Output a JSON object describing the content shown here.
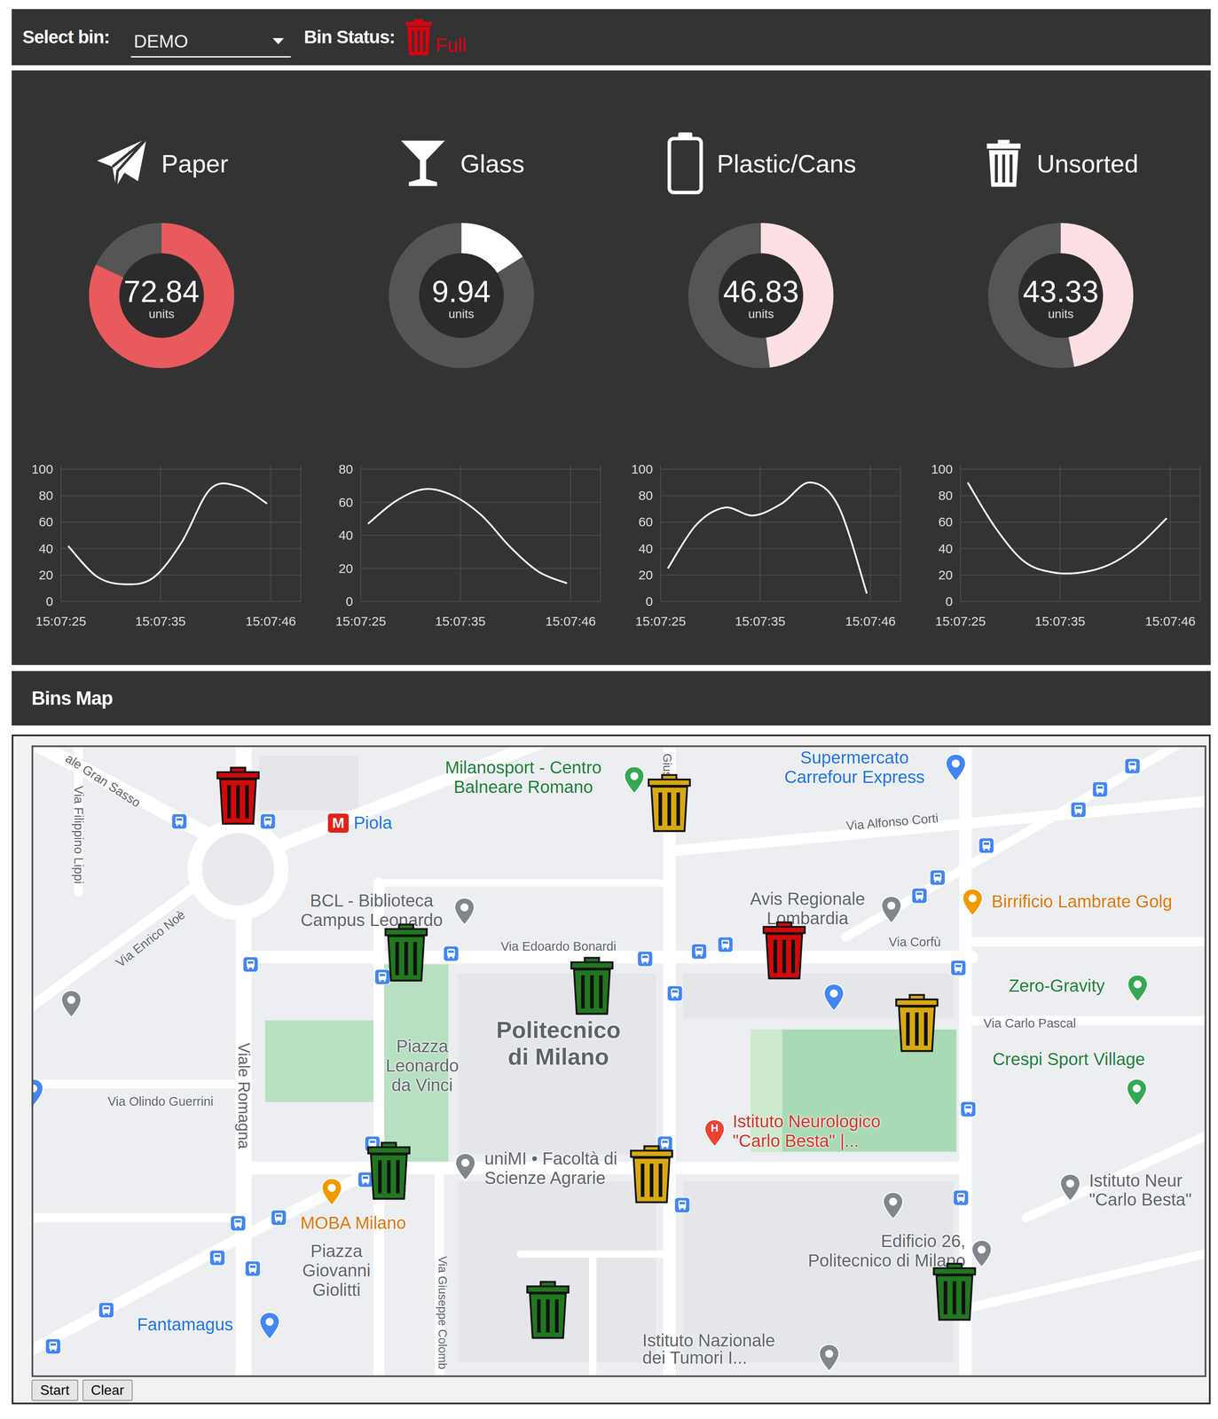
{
  "toolbar": {
    "select_label": "Select bin:",
    "selected_bin": "DEMO",
    "status_label": "Bin Status:",
    "status": "Full",
    "status_color": "#e0000f"
  },
  "gauges": [
    {
      "name": "Paper",
      "value": "72.84",
      "unit": "units",
      "level": 0.82,
      "color": "#e85a5e",
      "chart": {
        "y_ticks": [
          "100",
          "80",
          "60",
          "40",
          "20",
          "0"
        ],
        "x_ticks": [
          "15:07:25",
          "15:07:35",
          "15:07:46"
        ],
        "values": [
          42,
          19,
          13,
          18,
          45,
          85,
          87,
          74
        ]
      }
    },
    {
      "name": "Glass",
      "value": "9.94",
      "unit": "units",
      "level": 0.16,
      "color": "#ffffff",
      "chart": {
        "y_ticks": [
          "80",
          "60",
          "40",
          "20",
          "0"
        ],
        "x_ticks": [
          "15:07:25",
          "15:07:35",
          "15:07:46"
        ],
        "values": [
          47,
          61,
          68,
          64,
          52,
          33,
          18,
          11
        ]
      }
    },
    {
      "name": "Plastic/Cans",
      "value": "46.83",
      "unit": "units",
      "level": 0.48,
      "color": "#fcdfe2",
      "chart": {
        "y_ticks": [
          "100",
          "80",
          "60",
          "40",
          "20",
          "0"
        ],
        "x_ticks": [
          "15:07:25",
          "15:07:35",
          "15:07:46"
        ],
        "values": [
          25,
          58,
          71,
          65,
          74,
          90,
          72,
          6
        ]
      }
    },
    {
      "name": "Unsorted",
      "value": "43.33",
      "unit": "units",
      "level": 0.47,
      "color": "#fcdfe2",
      "chart": {
        "y_ticks": [
          "100",
          "80",
          "60",
          "40",
          "20",
          "0"
        ],
        "x_ticks": [
          "15:07:25",
          "15:07:35",
          "15:07:46"
        ],
        "values": [
          90,
          55,
          30,
          22,
          22,
          28,
          42,
          63
        ]
      }
    }
  ],
  "map": {
    "title": "Bins Map",
    "badges": {
      "metro": "M",
      "hospital": "H"
    },
    "labels": [
      {
        "kind": "place",
        "lines": [
          "Milanosport - Centro",
          "Balneare Romano"
        ],
        "color": "#188038"
      },
      {
        "kind": "place",
        "lines": [
          "Supermercato",
          "Carrefour Express"
        ],
        "color": "#1a73e8"
      },
      {
        "kind": "place",
        "lines": [
          "Piola"
        ],
        "color": "#1a73e8"
      },
      {
        "kind": "place",
        "lines": [
          "BCL - Biblioteca",
          "Campus Leonardo"
        ],
        "color": "#5f6368"
      },
      {
        "kind": "street",
        "lines": [
          "Via Edoardo Bonardi"
        ],
        "color": "#5f6368"
      },
      {
        "kind": "title",
        "lines": [
          "Politecnico",
          "di Milano"
        ],
        "color": "#5f6368"
      },
      {
        "kind": "area",
        "lines": [
          "Piazza",
          "Leonardo",
          "da Vinci"
        ],
        "color": "#5f6368"
      },
      {
        "kind": "place",
        "lines": [
          "Avis Regionale",
          "Lombardia"
        ],
        "color": "#5f6368"
      },
      {
        "kind": "place",
        "lines": [
          "Birrificio Lambrate Golg"
        ],
        "color": "#e37400"
      },
      {
        "kind": "street",
        "lines": [
          "Via Corfù"
        ],
        "color": "#5f6368"
      },
      {
        "kind": "place",
        "lines": [
          "Zero-Gravity"
        ],
        "color": "#188038"
      },
      {
        "kind": "street",
        "lines": [
          "Via Carlo Pascal"
        ],
        "color": "#5f6368"
      },
      {
        "kind": "place",
        "lines": [
          "Crespi Sport Village"
        ],
        "color": "#188038"
      },
      {
        "kind": "place",
        "lines": [
          "Istituto Neurologico",
          "\"Carlo Besta\" |..."
        ],
        "color": "#d93025"
      },
      {
        "kind": "place",
        "lines": [
          "uniMI • Facoltà di",
          "Scienze Agrarie"
        ],
        "color": "#5f6368"
      },
      {
        "kind": "place",
        "lines": [
          "Istituto Neur",
          "\"Carlo Besta\""
        ],
        "color": "#5f6368"
      },
      {
        "kind": "place",
        "lines": [
          "Edificio 26,",
          "Politecnico di Milano"
        ],
        "color": "#5f6368"
      },
      {
        "kind": "place",
        "lines": [
          "MOBA Milano"
        ],
        "color": "#e37400"
      },
      {
        "kind": "area",
        "lines": [
          "Piazza",
          "Giovanni",
          "Giolitti"
        ],
        "color": "#5f6368"
      },
      {
        "kind": "place",
        "lines": [
          "Fantamagus"
        ],
        "color": "#1a73e8"
      },
      {
        "kind": "place",
        "lines": [
          "Istituto Nazionale",
          "dei Tumori I..."
        ],
        "color": "#5f6368"
      },
      {
        "kind": "street",
        "lines": [
          "ale Gran Sasso"
        ],
        "color": "#5f6368"
      },
      {
        "kind": "street",
        "lines": [
          "Via Filippino Lippi"
        ],
        "color": "#5f6368"
      },
      {
        "kind": "street",
        "lines": [
          "Via Enrico Noè"
        ],
        "color": "#5f6368"
      },
      {
        "kind": "street",
        "lines": [
          "Viale Romagna"
        ],
        "color": "#5f6368"
      },
      {
        "kind": "street",
        "lines": [
          "Via Olindo Guerrini"
        ],
        "color": "#5f6368"
      },
      {
        "kind": "street",
        "lines": [
          "Via Alfonso Corti"
        ],
        "color": "#5f6368"
      },
      {
        "kind": "street",
        "lines": [
          "Via Giuseppe Colomb"
        ],
        "color": "#5f6368"
      },
      {
        "kind": "street",
        "lines": [
          "Giuse"
        ],
        "color": "#5f6368"
      }
    ],
    "bins": [
      {
        "color": "#d10a0a"
      },
      {
        "color": "#d8a910"
      },
      {
        "color": "#20781f"
      },
      {
        "color": "#20781f"
      },
      {
        "color": "#d10a0a"
      },
      {
        "color": "#d8a910"
      },
      {
        "color": "#20781f"
      },
      {
        "color": "#d8a910"
      },
      {
        "color": "#20781f"
      },
      {
        "color": "#20781f"
      }
    ],
    "buttons": [
      "Start",
      "Clear"
    ]
  }
}
